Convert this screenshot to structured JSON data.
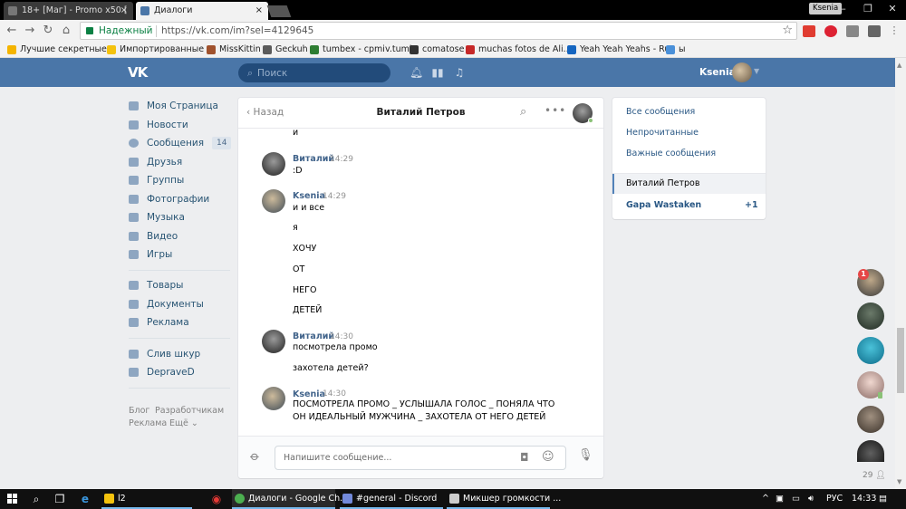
{
  "browser": {
    "tabs": [
      {
        "title": "18+ [Маг] - Promo x50 [",
        "close": "×",
        "icon_color": "#777777"
      },
      {
        "title": "Диалоги",
        "close": "×",
        "icon_color": "#4a76a8"
      }
    ],
    "profile_name": "Ksenia",
    "window_controls": [
      "–",
      "❐",
      "✕"
    ],
    "secure_label": "Надежный",
    "url": "https://vk.com/im?sel=4129645",
    "extensions": [
      {
        "name": "adblock-icon",
        "color": "#e03c31"
      },
      {
        "name": "extension-red-icon",
        "color": "#d23"
      },
      {
        "name": "extension-grid-icon",
        "color": "#888888"
      },
      {
        "name": "extension-gray-icon",
        "color": "#666666"
      }
    ],
    "bookmarks": [
      {
        "label": "Лучшие секретные р",
        "color": "#f4b400"
      },
      {
        "label": "Импортированные и",
        "color": "#f4c20d"
      },
      {
        "label": "MissKittin",
        "color": "#a0522d"
      },
      {
        "label": "Geckuh",
        "color": "#5b5b5b"
      },
      {
        "label": "tumbex - cpmiv.tumb",
        "color": "#2e7d32"
      },
      {
        "label": "comatose",
        "color": "#333333"
      },
      {
        "label": "muchas fotos de Ali...",
        "color": "#c62828"
      },
      {
        "label": "Yeah Yeah Yeahs - Ru",
        "color": "#1565c0"
      },
      {
        "label": "ы",
        "color": "#4a90d9"
      }
    ]
  },
  "vk": {
    "logo": "VK",
    "search_placeholder": "Поиск",
    "user_name": "Ksenia",
    "menu": [
      {
        "label": "Моя Страница",
        "name": "my-page"
      },
      {
        "label": "Новости",
        "name": "news"
      },
      {
        "label": "Сообщения",
        "name": "messages",
        "badge": "14"
      },
      {
        "label": "Друзья",
        "name": "friends"
      },
      {
        "label": "Группы",
        "name": "groups"
      },
      {
        "label": "Фотографии",
        "name": "photos"
      },
      {
        "label": "Музыка",
        "name": "music"
      },
      {
        "label": "Видео",
        "name": "video"
      },
      {
        "label": "Игры",
        "name": "games"
      }
    ],
    "menu2": [
      {
        "label": "Товары",
        "name": "goods"
      },
      {
        "label": "Документы",
        "name": "documents"
      },
      {
        "label": "Реклама",
        "name": "ads"
      }
    ],
    "menu3": [
      {
        "label": "Слив шкур",
        "name": "sliv-shkur"
      },
      {
        "label": "DepraveD",
        "name": "depraved"
      }
    ],
    "footer": {
      "blog": "Блог",
      "dev": "Разработчикам",
      "ads": "Реклама",
      "more": "Ещё ⌄"
    }
  },
  "chat": {
    "back": "Назад",
    "title": "Виталий Петров",
    "more": "•••",
    "input_placeholder": "Напишите сообщение...",
    "top_fragment": "и",
    "messages": [
      {
        "author": "Виталий",
        "time": "14:29",
        "who": "v",
        "lines": [
          ":D"
        ]
      },
      {
        "author": "Ksenia",
        "time": "14:29",
        "who": "k",
        "lines": [
          "и и все",
          "я",
          "ХОЧУ",
          "ОТ",
          "НЕГО",
          "ДЕТЕЙ"
        ]
      },
      {
        "author": "Виталий",
        "time": "14:30",
        "who": "v",
        "lines": [
          "посмотрела промо",
          "захотела детей?"
        ]
      },
      {
        "author": "Ksenia",
        "time": "14:30",
        "who": "k",
        "lines": [
          "ПОСМОТРЕЛА ПРОМО _ УСЛЫШАЛА ГОЛОС _ ПОНЯЛА ЧТО",
          "ОН ИДЕАЛЬНЫЙ МУЖЧИНА _ ЗАХОТЕЛА ОТ НЕГО ДЕТЕЙ"
        ]
      }
    ]
  },
  "right_panel": {
    "items": [
      "Все сообщения",
      "Непрочитанные",
      "Важные сообщения"
    ],
    "active": "Виталий Петров",
    "other": "Gapa Wastaken",
    "other_count": "+1"
  },
  "friends_bar": {
    "badge": "1",
    "count": "29"
  },
  "taskbar": {
    "apps": [
      {
        "label": "l2",
        "color": "#f4c20d"
      },
      {
        "label": "Диалоги - Google Ch...",
        "color": "#4caf50"
      },
      {
        "label": "#general - Discord",
        "color": "#7289da"
      },
      {
        "label": "Микшер громкости ...",
        "color": "#cccccc"
      }
    ],
    "lang": "РУС",
    "time": "14:33"
  }
}
